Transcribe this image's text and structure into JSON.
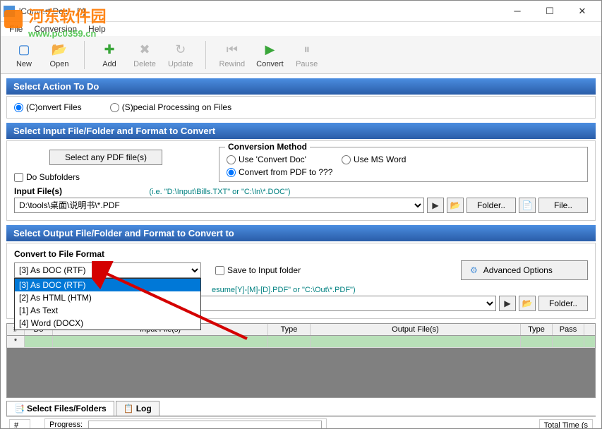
{
  "titlebar": {
    "text": "'Convert Doc' - [*]"
  },
  "menubar": {
    "file": "File",
    "conversion": "Conversion",
    "help": "Help"
  },
  "toolbar": {
    "new": "New",
    "open": "Open",
    "add": "Add",
    "delete": "Delete",
    "update": "Update",
    "rewind": "Rewind",
    "convert": "Convert",
    "pause": "Pause"
  },
  "sections": {
    "action": "Select Action To Do",
    "input": "Select Input File/Folder and Format to Convert",
    "output": "Select Output File/Folder and Format to Convert to"
  },
  "action": {
    "convert": "(C)onvert Files",
    "special": "(S)pecial Processing on Files"
  },
  "input": {
    "select_any_btn": "Select any PDF file(s)",
    "do_subfolders": "Do Subfolders",
    "input_files_label": "Input File(s)",
    "hint": "(i.e. \"D:\\Input\\Bills.TXT\" or \"C:\\In\\*.DOC\")",
    "path_value": "D:\\tools\\桌面\\说明书\\*.PDF",
    "folder_btn": "Folder..",
    "file_btn": "File.."
  },
  "conversion_method": {
    "legend": "Conversion Method",
    "use_convert_doc": "Use 'Convert Doc'",
    "use_ms_word": "Use MS Word",
    "convert_from_pdf": "Convert from PDF to ???"
  },
  "output": {
    "format_label": "Convert to File Format",
    "selected": "[3] As DOC (RTF)",
    "options": [
      "[3] As DOC (RTF)",
      "[2] As HTML (HTM)",
      "[1] As Text",
      "[4] Word (DOCX)"
    ],
    "save_to_input": "Save to Input folder",
    "advanced_btn": "Advanced Options",
    "hint": "esume[Y]-[M]-[D].PDF\" or \"C:\\Out\\*.PDF\")",
    "folder_btn": "Folder.."
  },
  "grid": {
    "cols": {
      "num": "#",
      "do": "Do",
      "input": "Input File(s)",
      "type1": "Type",
      "output": "Output File(s)",
      "type2": "Type",
      "pass": "Pass"
    },
    "new_marker": "*"
  },
  "tabs": {
    "select": "Select Files/Folders",
    "log": "Log"
  },
  "status": {
    "num": "#",
    "progress": "Progress:",
    "total_time": "Total Time (s"
  },
  "watermark": {
    "main": "河东软件园",
    "sub": "www.pc0359.cn"
  }
}
